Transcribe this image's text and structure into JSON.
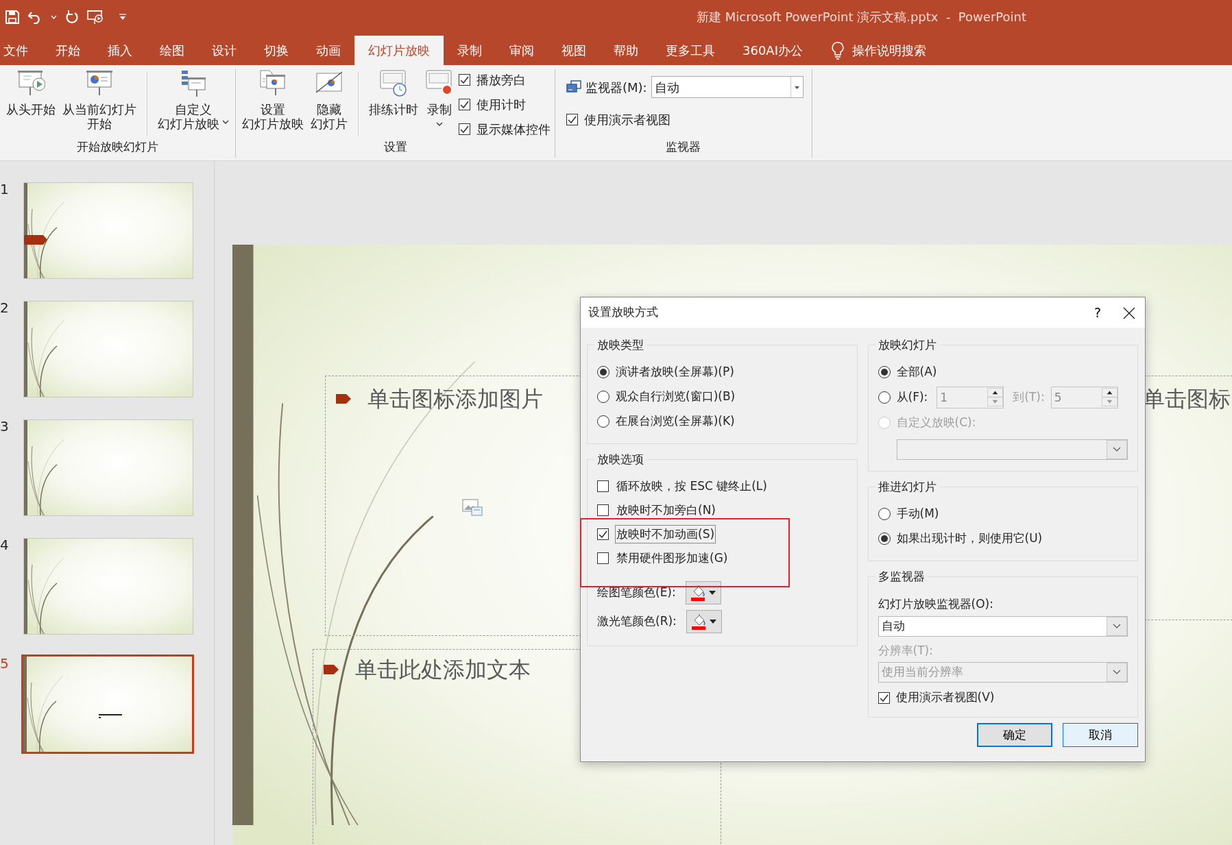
{
  "window": {
    "title": "新建 Microsoft PowerPoint 演示文稿.pptx  -  PowerPoint"
  },
  "tabs": [
    {
      "label": "文件",
      "selected": false
    },
    {
      "label": "开始",
      "selected": false
    },
    {
      "label": "插入",
      "selected": false
    },
    {
      "label": "绘图",
      "selected": false
    },
    {
      "label": "设计",
      "selected": false
    },
    {
      "label": "切换",
      "selected": false
    },
    {
      "label": "动画",
      "selected": false
    },
    {
      "label": "幻灯片放映",
      "selected": true
    },
    {
      "label": "录制",
      "selected": false
    },
    {
      "label": "审阅",
      "selected": false
    },
    {
      "label": "视图",
      "selected": false
    },
    {
      "label": "帮助",
      "selected": false
    },
    {
      "label": "更多工具",
      "selected": false
    },
    {
      "label": "360AI办公",
      "selected": false
    }
  ],
  "tell_me": {
    "label": "操作说明搜索"
  },
  "ribbon": {
    "groups": [
      {
        "label": "开始放映幻灯片",
        "items": [
          {
            "kind": "large",
            "lines": [
              "从头开始"
            ]
          },
          {
            "kind": "large",
            "lines": [
              "从当前幻灯片",
              "开始"
            ]
          },
          {
            "kind": "separator"
          },
          {
            "kind": "menu",
            "lines": [
              "自定义",
              "幻灯片放映"
            ]
          }
        ]
      },
      {
        "label": "设置",
        "items": [
          {
            "kind": "large",
            "lines": [
              "设置",
              "幻灯片放映"
            ]
          },
          {
            "kind": "large",
            "lines": [
              "隐藏",
              "幻灯片"
            ]
          },
          {
            "kind": "separator"
          },
          {
            "kind": "large",
            "lines": [
              "排练计时"
            ]
          },
          {
            "kind": "split",
            "lines": [
              "录制"
            ]
          },
          {
            "kind": "checks",
            "items": [
              {
                "label": "播放旁白",
                "checked": true
              },
              {
                "label": "使用计时",
                "checked": true
              },
              {
                "label": "显示媒体控件",
                "checked": true
              }
            ]
          }
        ]
      },
      {
        "label": "监视器",
        "items": [
          {
            "kind": "monitor",
            "label": "监视器(M):",
            "value": "自动",
            "checkbox": {
              "label": "使用演示者视图",
              "checked": true
            }
          }
        ]
      }
    ]
  },
  "slides_panel": {
    "slides": [
      {
        "number": "1",
        "selected": false,
        "kind": "title"
      },
      {
        "number": "2",
        "selected": false,
        "kind": "blank"
      },
      {
        "number": "3",
        "selected": false,
        "kind": "blank"
      },
      {
        "number": "4",
        "selected": false,
        "kind": "blank"
      },
      {
        "number": "5",
        "selected": true,
        "kind": "content"
      }
    ]
  },
  "slide": {
    "placeholders": [
      {
        "kind": "picture",
        "text": "单击图标添加图片"
      },
      {
        "kind": "text",
        "text": "单击此处添加文本"
      },
      {
        "kind": "picture",
        "text": "单击图标"
      }
    ]
  },
  "dialog": {
    "title": "设置放映方式",
    "help": "?",
    "show_type": {
      "title": "放映类型",
      "options": [
        {
          "label": "演讲者放映(全屏幕)(P)",
          "selected": true
        },
        {
          "label": "观众自行浏览(窗口)(B)",
          "selected": false
        },
        {
          "label": "在展台浏览(全屏幕)(K)",
          "selected": false
        }
      ]
    },
    "show_options": {
      "title": "放映选项",
      "options": [
        {
          "label": "循环放映，按 ESC 键终止(L)",
          "checked": false,
          "focused": false
        },
        {
          "label": "放映时不加旁白(N)",
          "checked": false,
          "focused": false
        },
        {
          "label": "放映时不加动画(S)",
          "checked": true,
          "focused": true
        },
        {
          "label": "禁用硬件图形加速(G)",
          "checked": false,
          "focused": false
        }
      ],
      "pens": [
        {
          "label": "绘图笔颜色(E):",
          "color": "#ff0000"
        },
        {
          "label": "激光笔颜色(R):",
          "color": "#ff0000"
        }
      ]
    },
    "show_slides": {
      "title": "放映幻灯片",
      "options": [
        {
          "kind": "plain",
          "label": "全部(A)",
          "selected": true,
          "disabled": false
        },
        {
          "kind": "range",
          "label": "从(F):",
          "selected": false,
          "disabled": false,
          "from": "1",
          "to_label": "到(T):",
          "to": "5"
        },
        {
          "kind": "custom",
          "label": "自定义放映(C):",
          "selected": false,
          "disabled": true
        }
      ]
    },
    "advance": {
      "title": "推进幻灯片",
      "options": [
        {
          "label": "手动(M)",
          "selected": false
        },
        {
          "label": "如果出现计时，则使用它(U)",
          "selected": true
        }
      ]
    },
    "monitors": {
      "title": "多监视器",
      "monitor_label": "幻灯片放映监视器(O):",
      "monitor_value": "自动",
      "resolution_label": "分辨率(T):",
      "resolution_value": "使用当前分辨率",
      "resolution_disabled": true,
      "presenter_view": {
        "label": "使用演示者视图(V)",
        "checked": true
      }
    },
    "buttons": [
      {
        "label": "确定",
        "default": true
      },
      {
        "label": "取消",
        "default": false
      }
    ]
  },
  "annotation": {
    "kind": "rectangle"
  }
}
